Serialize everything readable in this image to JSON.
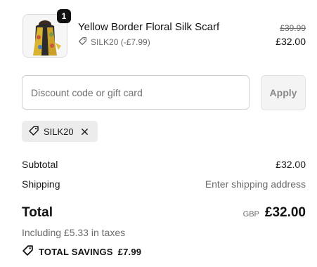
{
  "cart": {
    "item": {
      "quantity": "1",
      "name": "Yellow Border Floral Silk Scarf",
      "discount_label": "SILK20 (-£7.99)",
      "original_price": "£39.99",
      "price": "£32.00",
      "image_icon": "scarf-product-image"
    }
  },
  "discount": {
    "placeholder": "Discount code or gift card",
    "apply_label": "Apply",
    "applied_code": "SILK20"
  },
  "summary": {
    "subtotal_label": "Subtotal",
    "subtotal_value": "£32.00",
    "shipping_label": "Shipping",
    "shipping_value": "Enter shipping address",
    "total_label": "Total",
    "currency": "GBP",
    "total_value": "£32.00",
    "taxes_text": "Including £5.33 in taxes",
    "savings_label": "TOTAL SAVINGS",
    "savings_value": "£7.99"
  },
  "colors": {
    "text": "#1a1a1a",
    "muted": "#6b6b6b",
    "chip_bg": "#ececec",
    "apply_bg": "#f4f4f4",
    "badge_bg": "#111111"
  }
}
